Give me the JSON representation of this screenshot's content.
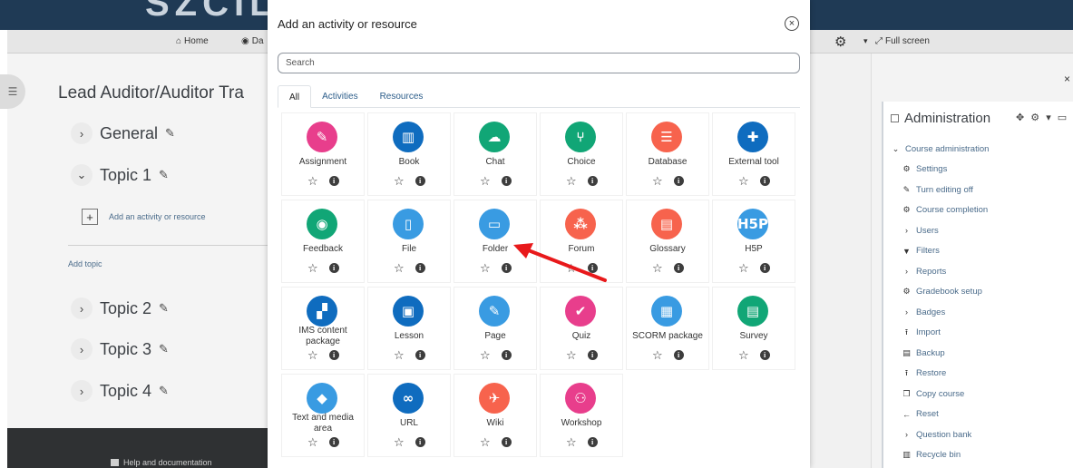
{
  "site": {
    "brand": "SZCIL"
  },
  "navbar": {
    "home": "Home",
    "dashboard": "Da",
    "fullscreen": "Full screen"
  },
  "course": {
    "title": "Lead Auditor/Auditor Tra",
    "sections": [
      "General",
      "Topic 1",
      "Topic 2",
      "Topic 3",
      "Topic 4"
    ],
    "add_activity": "Add an activity or resource",
    "add_topic": "Add topic"
  },
  "footer": {
    "help": "Help and documentation"
  },
  "admin": {
    "title": "Administration",
    "items": [
      {
        "label": "Course administration",
        "icon": "chevron-down-icon"
      },
      {
        "label": "Settings",
        "icon": "gear-icon"
      },
      {
        "label": "Turn editing off",
        "icon": "pencil-icon"
      },
      {
        "label": "Course completion",
        "icon": "gear-icon"
      },
      {
        "label": "Users",
        "icon": "chevron-right-icon"
      },
      {
        "label": "Filters",
        "icon": "filter-icon"
      },
      {
        "label": "Reports",
        "icon": "chevron-right-icon"
      },
      {
        "label": "Gradebook setup",
        "icon": "gear-icon"
      },
      {
        "label": "Badges",
        "icon": "chevron-right-icon"
      },
      {
        "label": "Import",
        "icon": "upload-icon"
      },
      {
        "label": "Backup",
        "icon": "file-icon"
      },
      {
        "label": "Restore",
        "icon": "upload-icon"
      },
      {
        "label": "Copy course",
        "icon": "copy-icon"
      },
      {
        "label": "Reset",
        "icon": "arrow-left-icon"
      },
      {
        "label": "Question bank",
        "icon": "chevron-right-icon"
      },
      {
        "label": "Recycle bin",
        "icon": "trash-icon"
      }
    ]
  },
  "modal": {
    "title": "Add an activity or resource",
    "search_placeholder": "Search",
    "tabs": [
      "All",
      "Activities",
      "Resources"
    ],
    "activities": [
      {
        "name": "Assignment",
        "color": "#e83e8c",
        "glyph": "✎"
      },
      {
        "name": "Book",
        "color": "#0f6cbf",
        "glyph": "▥"
      },
      {
        "name": "Chat",
        "color": "#11a676",
        "glyph": "☁"
      },
      {
        "name": "Choice",
        "color": "#11a676",
        "glyph": "⑂"
      },
      {
        "name": "Database",
        "color": "#f7634d",
        "glyph": "☰"
      },
      {
        "name": "External tool",
        "color": "#0f6cbf",
        "glyph": "✚"
      },
      {
        "name": "Feedback",
        "color": "#11a676",
        "glyph": "◉"
      },
      {
        "name": "File",
        "color": "#399be2",
        "glyph": "▯"
      },
      {
        "name": "Folder",
        "color": "#399be2",
        "glyph": "▭"
      },
      {
        "name": "Forum",
        "color": "#f7634d",
        "glyph": "⁂"
      },
      {
        "name": "Glossary",
        "color": "#f7634d",
        "glyph": "▤"
      },
      {
        "name": "H5P",
        "color": "#399be2",
        "glyph": "H5P"
      },
      {
        "name": "IMS content package",
        "color": "#0f6cbf",
        "glyph": "▞"
      },
      {
        "name": "Lesson",
        "color": "#0f6cbf",
        "glyph": "▣"
      },
      {
        "name": "Page",
        "color": "#399be2",
        "glyph": "✎"
      },
      {
        "name": "Quiz",
        "color": "#e83e8c",
        "glyph": "✔"
      },
      {
        "name": "SCORM package",
        "color": "#399be2",
        "glyph": "▦"
      },
      {
        "name": "Survey",
        "color": "#11a676",
        "glyph": "▤"
      },
      {
        "name": "Text and media area",
        "color": "#399be2",
        "glyph": "◆"
      },
      {
        "name": "URL",
        "color": "#0f6cbf",
        "glyph": "∞"
      },
      {
        "name": "Wiki",
        "color": "#f7634d",
        "glyph": "✈"
      },
      {
        "name": "Workshop",
        "color": "#e83e8c",
        "glyph": "⚇"
      }
    ]
  },
  "annotation": {
    "arrow_color": "#e8191b"
  }
}
